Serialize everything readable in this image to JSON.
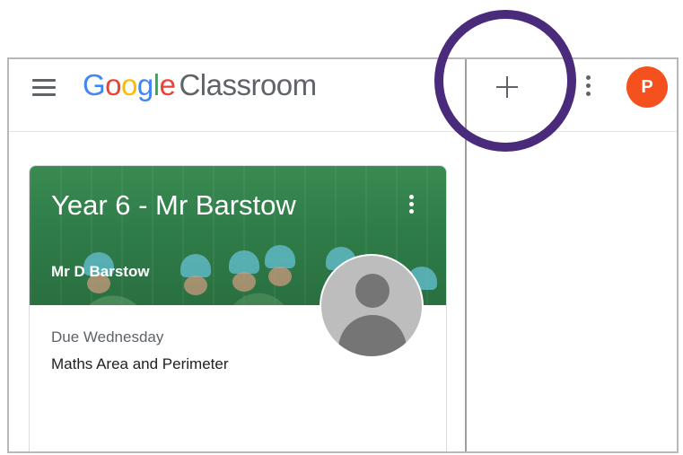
{
  "header": {
    "logo_letters": [
      "G",
      "o",
      "o",
      "g",
      "l",
      "e"
    ],
    "product_name": "Classroom",
    "avatar_initial": "P"
  },
  "class_card": {
    "title": "Year 6 - Mr Barstow",
    "teacher": "Mr D Barstow",
    "due_label": "Due Wednesday",
    "assignment": "Maths Area and Perimeter"
  },
  "colors": {
    "google_blue": "#4285f4",
    "google_red": "#ea4335",
    "google_yellow": "#fbbc05",
    "google_green": "#34a853",
    "avatar_orange": "#f4511e",
    "card_header_green": "#2f7d49",
    "highlight_purple": "#4a2a7a"
  },
  "icons": {
    "menu": "hamburger-menu-icon",
    "create": "plus-icon",
    "apps": "more-vert-icon",
    "card_options": "more-vert-icon",
    "teacher_photo": "default-person-icon"
  }
}
